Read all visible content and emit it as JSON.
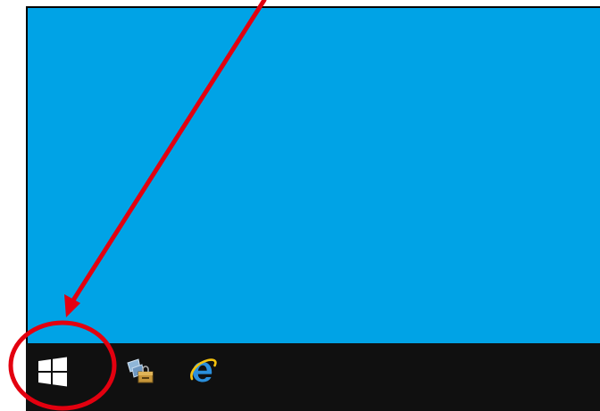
{
  "desktop": {
    "background_color": "#00a3e6"
  },
  "taskbar": {
    "background_color": "#101010",
    "items": [
      {
        "name": "start-button",
        "icon": "windows-logo-icon"
      },
      {
        "name": "server-manager-button",
        "icon": "server-manager-icon"
      },
      {
        "name": "internet-explorer-button",
        "icon": "internet-explorer-icon"
      }
    ]
  },
  "annotation": {
    "color": "#e3000f",
    "arrow_target": "start-button",
    "circle_target": "start-button"
  }
}
